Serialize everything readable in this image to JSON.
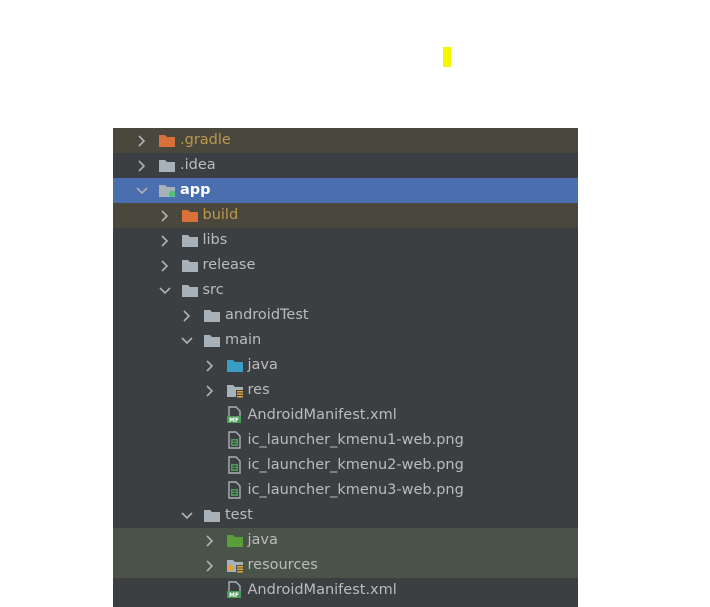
{
  "colors": {
    "panel_bg": "#3c3f41",
    "selection": "#4b6eaf",
    "excluded_bg": "#4a473d",
    "test_resource_bg": "#495349",
    "text": "#bbbbbb",
    "excluded_text": "#bb9a4d"
  },
  "project_tree": {
    "items": [
      {
        "label": ".gradle",
        "depth": 0,
        "expandable": true,
        "expanded": false,
        "icon": "folder-excluded-icon",
        "style": "excluded"
      },
      {
        "label": ".idea",
        "depth": 0,
        "expandable": true,
        "expanded": false,
        "icon": "folder-icon",
        "style": "normal"
      },
      {
        "label": "app",
        "depth": 0,
        "expandable": true,
        "expanded": true,
        "icon": "module-folder-icon",
        "style": "selected"
      },
      {
        "label": "build",
        "depth": 1,
        "expandable": true,
        "expanded": false,
        "icon": "folder-excluded-icon",
        "style": "excluded"
      },
      {
        "label": "libs",
        "depth": 1,
        "expandable": true,
        "expanded": false,
        "icon": "folder-icon",
        "style": "normal"
      },
      {
        "label": "release",
        "depth": 1,
        "expandable": true,
        "expanded": false,
        "icon": "folder-icon",
        "style": "normal"
      },
      {
        "label": "src",
        "depth": 1,
        "expandable": true,
        "expanded": true,
        "icon": "folder-icon",
        "style": "normal"
      },
      {
        "label": "androidTest",
        "depth": 2,
        "expandable": true,
        "expanded": false,
        "icon": "folder-icon",
        "style": "normal"
      },
      {
        "label": "main",
        "depth": 2,
        "expandable": true,
        "expanded": true,
        "icon": "folder-icon",
        "style": "normal"
      },
      {
        "label": "java",
        "depth": 3,
        "expandable": true,
        "expanded": false,
        "icon": "source-folder-icon",
        "style": "normal"
      },
      {
        "label": "res",
        "depth": 3,
        "expandable": true,
        "expanded": false,
        "icon": "resources-folder-icon",
        "style": "normal"
      },
      {
        "label": "AndroidManifest.xml",
        "depth": 3,
        "expandable": false,
        "icon": "manifest-file-icon",
        "style": "normal"
      },
      {
        "label": "ic_launcher_kmenu1-web.png",
        "depth": 3,
        "expandable": false,
        "icon": "image-file-icon",
        "style": "normal"
      },
      {
        "label": "ic_launcher_kmenu2-web.png",
        "depth": 3,
        "expandable": false,
        "icon": "image-file-icon",
        "style": "normal"
      },
      {
        "label": "ic_launcher_kmenu3-web.png",
        "depth": 3,
        "expandable": false,
        "icon": "image-file-icon",
        "style": "normal"
      },
      {
        "label": "test",
        "depth": 2,
        "expandable": true,
        "expanded": true,
        "icon": "folder-icon",
        "style": "normal"
      },
      {
        "label": "java",
        "depth": 3,
        "expandable": true,
        "expanded": false,
        "icon": "test-source-folder-icon",
        "style": "test"
      },
      {
        "label": "resources",
        "depth": 3,
        "expandable": true,
        "expanded": false,
        "icon": "test-resources-folder-icon",
        "style": "test"
      },
      {
        "label": "AndroidManifest.xml",
        "depth": 3,
        "expandable": false,
        "icon": "manifest-file-icon",
        "style": "normal"
      }
    ]
  }
}
